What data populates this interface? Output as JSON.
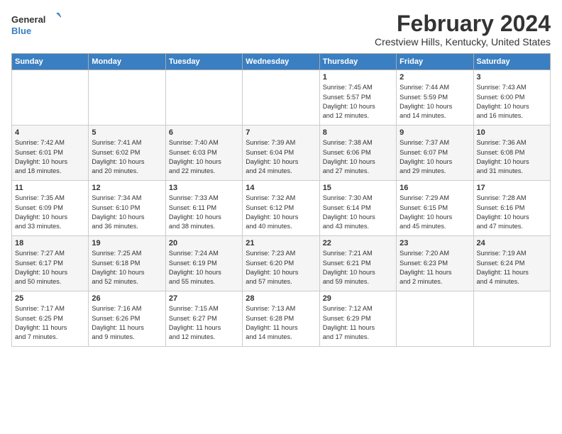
{
  "logo": {
    "line1": "General",
    "line2": "Blue"
  },
  "title": "February 2024",
  "location": "Crestview Hills, Kentucky, United States",
  "days_of_week": [
    "Sunday",
    "Monday",
    "Tuesday",
    "Wednesday",
    "Thursday",
    "Friday",
    "Saturday"
  ],
  "weeks": [
    [
      {
        "day": "",
        "info": ""
      },
      {
        "day": "",
        "info": ""
      },
      {
        "day": "",
        "info": ""
      },
      {
        "day": "",
        "info": ""
      },
      {
        "day": "1",
        "info": "Sunrise: 7:45 AM\nSunset: 5:57 PM\nDaylight: 10 hours\nand 12 minutes."
      },
      {
        "day": "2",
        "info": "Sunrise: 7:44 AM\nSunset: 5:59 PM\nDaylight: 10 hours\nand 14 minutes."
      },
      {
        "day": "3",
        "info": "Sunrise: 7:43 AM\nSunset: 6:00 PM\nDaylight: 10 hours\nand 16 minutes."
      }
    ],
    [
      {
        "day": "4",
        "info": "Sunrise: 7:42 AM\nSunset: 6:01 PM\nDaylight: 10 hours\nand 18 minutes."
      },
      {
        "day": "5",
        "info": "Sunrise: 7:41 AM\nSunset: 6:02 PM\nDaylight: 10 hours\nand 20 minutes."
      },
      {
        "day": "6",
        "info": "Sunrise: 7:40 AM\nSunset: 6:03 PM\nDaylight: 10 hours\nand 22 minutes."
      },
      {
        "day": "7",
        "info": "Sunrise: 7:39 AM\nSunset: 6:04 PM\nDaylight: 10 hours\nand 24 minutes."
      },
      {
        "day": "8",
        "info": "Sunrise: 7:38 AM\nSunset: 6:06 PM\nDaylight: 10 hours\nand 27 minutes."
      },
      {
        "day": "9",
        "info": "Sunrise: 7:37 AM\nSunset: 6:07 PM\nDaylight: 10 hours\nand 29 minutes."
      },
      {
        "day": "10",
        "info": "Sunrise: 7:36 AM\nSunset: 6:08 PM\nDaylight: 10 hours\nand 31 minutes."
      }
    ],
    [
      {
        "day": "11",
        "info": "Sunrise: 7:35 AM\nSunset: 6:09 PM\nDaylight: 10 hours\nand 33 minutes."
      },
      {
        "day": "12",
        "info": "Sunrise: 7:34 AM\nSunset: 6:10 PM\nDaylight: 10 hours\nand 36 minutes."
      },
      {
        "day": "13",
        "info": "Sunrise: 7:33 AM\nSunset: 6:11 PM\nDaylight: 10 hours\nand 38 minutes."
      },
      {
        "day": "14",
        "info": "Sunrise: 7:32 AM\nSunset: 6:12 PM\nDaylight: 10 hours\nand 40 minutes."
      },
      {
        "day": "15",
        "info": "Sunrise: 7:30 AM\nSunset: 6:14 PM\nDaylight: 10 hours\nand 43 minutes."
      },
      {
        "day": "16",
        "info": "Sunrise: 7:29 AM\nSunset: 6:15 PM\nDaylight: 10 hours\nand 45 minutes."
      },
      {
        "day": "17",
        "info": "Sunrise: 7:28 AM\nSunset: 6:16 PM\nDaylight: 10 hours\nand 47 minutes."
      }
    ],
    [
      {
        "day": "18",
        "info": "Sunrise: 7:27 AM\nSunset: 6:17 PM\nDaylight: 10 hours\nand 50 minutes."
      },
      {
        "day": "19",
        "info": "Sunrise: 7:25 AM\nSunset: 6:18 PM\nDaylight: 10 hours\nand 52 minutes."
      },
      {
        "day": "20",
        "info": "Sunrise: 7:24 AM\nSunset: 6:19 PM\nDaylight: 10 hours\nand 55 minutes."
      },
      {
        "day": "21",
        "info": "Sunrise: 7:23 AM\nSunset: 6:20 PM\nDaylight: 10 hours\nand 57 minutes."
      },
      {
        "day": "22",
        "info": "Sunrise: 7:21 AM\nSunset: 6:21 PM\nDaylight: 10 hours\nand 59 minutes."
      },
      {
        "day": "23",
        "info": "Sunrise: 7:20 AM\nSunset: 6:23 PM\nDaylight: 11 hours\nand 2 minutes."
      },
      {
        "day": "24",
        "info": "Sunrise: 7:19 AM\nSunset: 6:24 PM\nDaylight: 11 hours\nand 4 minutes."
      }
    ],
    [
      {
        "day": "25",
        "info": "Sunrise: 7:17 AM\nSunset: 6:25 PM\nDaylight: 11 hours\nand 7 minutes."
      },
      {
        "day": "26",
        "info": "Sunrise: 7:16 AM\nSunset: 6:26 PM\nDaylight: 11 hours\nand 9 minutes."
      },
      {
        "day": "27",
        "info": "Sunrise: 7:15 AM\nSunset: 6:27 PM\nDaylight: 11 hours\nand 12 minutes."
      },
      {
        "day": "28",
        "info": "Sunrise: 7:13 AM\nSunset: 6:28 PM\nDaylight: 11 hours\nand 14 minutes."
      },
      {
        "day": "29",
        "info": "Sunrise: 7:12 AM\nSunset: 6:29 PM\nDaylight: 11 hours\nand 17 minutes."
      },
      {
        "day": "",
        "info": ""
      },
      {
        "day": "",
        "info": ""
      }
    ]
  ]
}
